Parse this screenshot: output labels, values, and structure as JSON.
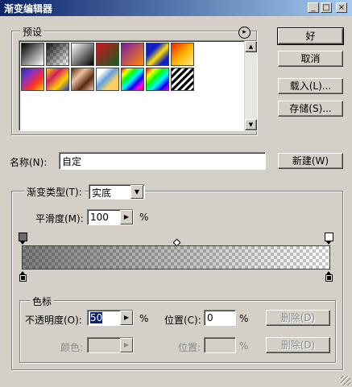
{
  "window": {
    "title": "渐变编辑器",
    "minimize": "_",
    "maximize": "□",
    "close": "×"
  },
  "presets": {
    "label": "预设",
    "menu_icon": "▸"
  },
  "buttons": {
    "ok": "好",
    "cancel": "取消",
    "load": "载入(L)...",
    "save": "存储(S)...",
    "new": "新建(W)"
  },
  "name": {
    "label": "名称(N):",
    "value": "自定"
  },
  "gradient_type": {
    "label": "渐变类型(T):",
    "value": "实底"
  },
  "smoothness": {
    "label": "平滑度(M):",
    "value": "100",
    "unit": "%"
  },
  "stops": {
    "group_label": "色标",
    "opacity_label": "不透明度(O):",
    "opacity_value": "50",
    "opacity_unit": "%",
    "position_label": "位置(C):",
    "position_value": "0",
    "position_unit": "%",
    "delete_label": "删除(D)",
    "color_label": "颜色:",
    "color_position_label": "位置:",
    "color_position_unit": "%",
    "color_delete_label": "删除(D)"
  },
  "colors": {
    "title_start": "#0a246a",
    "title_end": "#a6caf0",
    "face": "#d4d0c8",
    "selection": "#0a246a"
  }
}
